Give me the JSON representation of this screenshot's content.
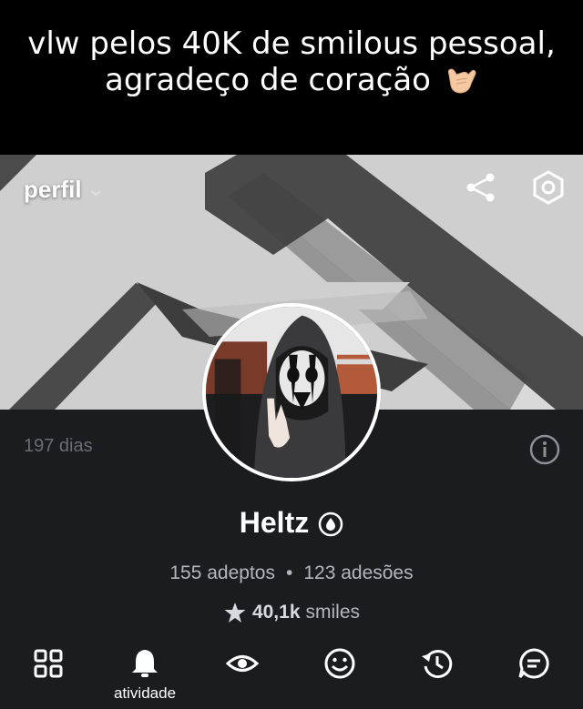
{
  "caption": {
    "line1": "vlw pelos 40K de smilous pessoal,",
    "line2": "agradeço de coração",
    "emoji": "call-me-hand-icon"
  },
  "topbar": {
    "title": "perfil",
    "title_icon": "chevron-down-icon",
    "share_icon": "share-icon",
    "settings_icon": "hexagon-settings-icon"
  },
  "profile": {
    "days": "197 dias",
    "name": "Heltz",
    "name_badge_icon": "drop-icon",
    "followers": "155 adeptos",
    "separator": "•",
    "adhesions": "123 adesões",
    "smiles_count": "40,1k",
    "smiles_label": "smiles"
  },
  "nav": {
    "items": [
      {
        "icon": "grid-icon",
        "label": ""
      },
      {
        "icon": "bell-icon",
        "label": "atividade"
      },
      {
        "icon": "eye-icon",
        "label": ""
      },
      {
        "icon": "smiley-icon",
        "label": ""
      },
      {
        "icon": "history-icon",
        "label": ""
      },
      {
        "icon": "chat-icon",
        "label": ""
      }
    ]
  },
  "colors": {
    "background": "#000000",
    "profile_bg": "#1b1c1e",
    "muted_text": "#6c6d71",
    "stat_text": "#b5b6ba"
  }
}
